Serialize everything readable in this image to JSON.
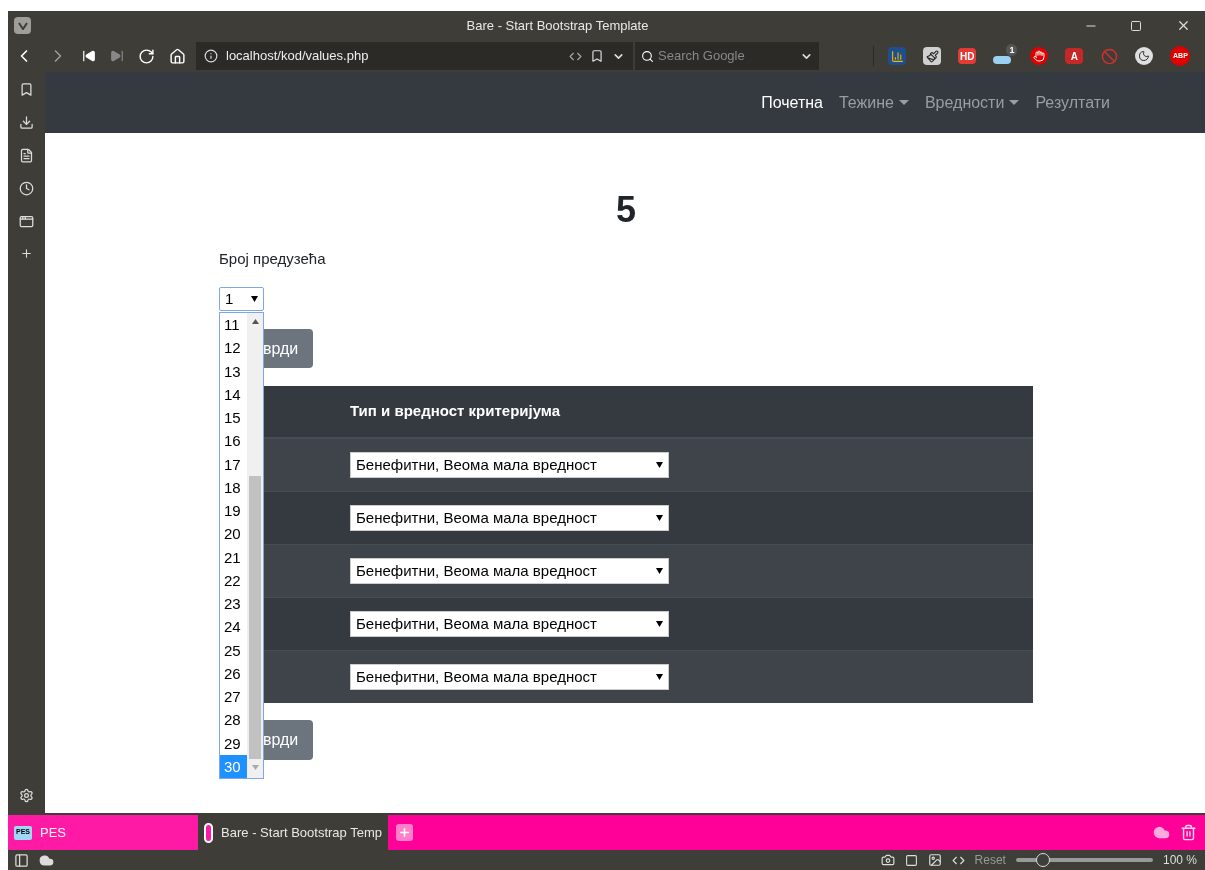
{
  "window": {
    "title": "Bare - Start Bootstrap Template"
  },
  "address_bar": {
    "url": "localhost/kod/values.php"
  },
  "search": {
    "placeholder": "Search Google"
  },
  "extensions": [
    {
      "kind": "chart",
      "color": "#1f4e8c"
    },
    {
      "kind": "brush",
      "color": "#d0d0d0"
    },
    {
      "kind": "badge",
      "label": "HD",
      "color": "#e53935"
    },
    {
      "kind": "counter",
      "label": "1",
      "color": "#9ad0f0"
    },
    {
      "kind": "hand",
      "color": "#e00000"
    },
    {
      "kind": "badge",
      "label": "A",
      "color": "#c62828"
    },
    {
      "kind": "blocked",
      "color": "#d32f2f"
    },
    {
      "kind": "moon",
      "color": "#e0e0e0"
    },
    {
      "kind": "round",
      "label": "ABP",
      "color": "#e00000"
    }
  ],
  "navbar": [
    {
      "label": "Почетна",
      "selected": true,
      "dropdown": false
    },
    {
      "label": "Тежине",
      "selected": false,
      "dropdown": true
    },
    {
      "label": "Вредности",
      "selected": false,
      "dropdown": true
    },
    {
      "label": "Резултати",
      "selected": false,
      "dropdown": false
    }
  ],
  "page": {
    "heading": "5",
    "field_label": "Број предузећа",
    "select_value": "1",
    "options": [
      {
        "label": "11",
        "selected": false
      },
      {
        "label": "12",
        "selected": false
      },
      {
        "label": "13",
        "selected": false
      },
      {
        "label": "14",
        "selected": false
      },
      {
        "label": "15",
        "selected": false
      },
      {
        "label": "16",
        "selected": false
      },
      {
        "label": "17",
        "selected": false
      },
      {
        "label": "18",
        "selected": false
      },
      {
        "label": "19",
        "selected": false
      },
      {
        "label": "20",
        "selected": false
      },
      {
        "label": "21",
        "selected": false
      },
      {
        "label": "22",
        "selected": false
      },
      {
        "label": "23",
        "selected": false
      },
      {
        "label": "24",
        "selected": false
      },
      {
        "label": "25",
        "selected": false
      },
      {
        "label": "26",
        "selected": false
      },
      {
        "label": "27",
        "selected": false
      },
      {
        "label": "28",
        "selected": false
      },
      {
        "label": "29",
        "selected": false
      },
      {
        "label": "30",
        "selected": true
      }
    ],
    "buttons": [
      "врди",
      "врди"
    ],
    "table": {
      "column_2": "Тип и вредност критеријума",
      "rows": [
        {
          "value": "Бенефитни, Веома мала вредност"
        },
        {
          "value": "Бенефитни, Веома мала вредност"
        },
        {
          "value": "Бенефитни, Веома мала вредност"
        },
        {
          "value": "Бенефитни, Веома мала вредност"
        },
        {
          "value": "Бенефитни, Веома мала вредност"
        }
      ]
    }
  },
  "tabs": [
    {
      "label": "PES",
      "icon_label": "PES",
      "selected": false
    },
    {
      "label": "Bare - Start Bootstrap Temp",
      "selected": true
    }
  ],
  "status_bar": {
    "reset": "Reset",
    "level": 0.2,
    "reading": "100 %"
  }
}
